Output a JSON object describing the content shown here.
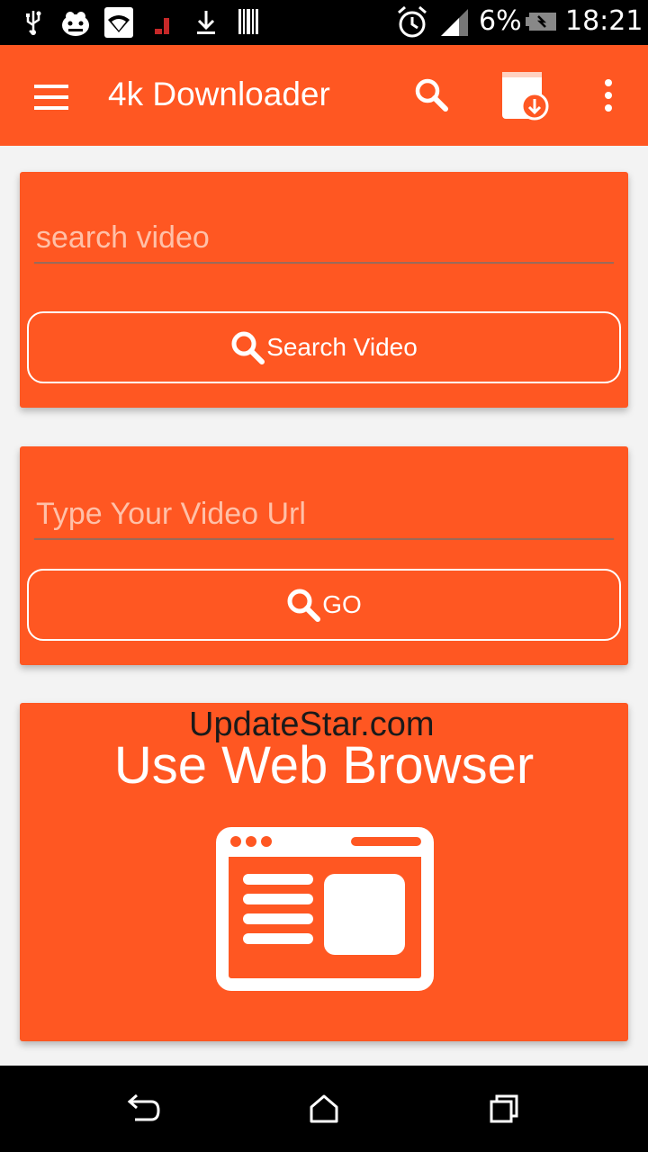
{
  "statusbar": {
    "battery_percent": "6%",
    "time": "18:21",
    "icons": [
      "usb-icon",
      "android-debug-icon",
      "wifi-icon",
      "signal-red-icon",
      "download-icon",
      "barcode-icon",
      "alarm-icon",
      "cell-signal-icon",
      "battery-low-icon"
    ]
  },
  "appbar": {
    "title": "4k Downloader",
    "icons": [
      "menu-icon",
      "search-icon",
      "downloads-icon",
      "more-vert-icon"
    ]
  },
  "search_card": {
    "placeholder": "search video",
    "button_label": "Search Video"
  },
  "url_card": {
    "placeholder": "Type Your Video Url",
    "button_label": "GO"
  },
  "browser_card": {
    "title": "Use Web Browser",
    "icon": "web-browser-icon"
  },
  "watermark": "UpdateStar.com",
  "navbar": {
    "icons": [
      "back-icon",
      "home-icon",
      "recents-icon"
    ]
  },
  "colors": {
    "accent": "#ff5722",
    "statusbar": "#000000",
    "background": "#f3f3f3"
  }
}
